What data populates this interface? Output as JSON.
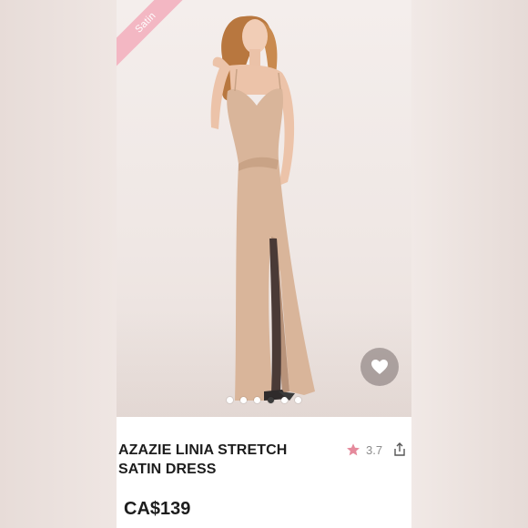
{
  "badge": {
    "label": "Satin",
    "color": "#f3b7c3"
  },
  "product": {
    "title": "AZAZIE LINIA STRETCH SATIN DRESS",
    "price": "CA$139",
    "rating": "3.7",
    "rating_icon": "star-icon",
    "rating_color": "#e58a9c"
  },
  "gallery": {
    "image_count": 6,
    "active_index": 3,
    "favorite_icon": "heart-icon",
    "share_icon": "share-icon"
  }
}
